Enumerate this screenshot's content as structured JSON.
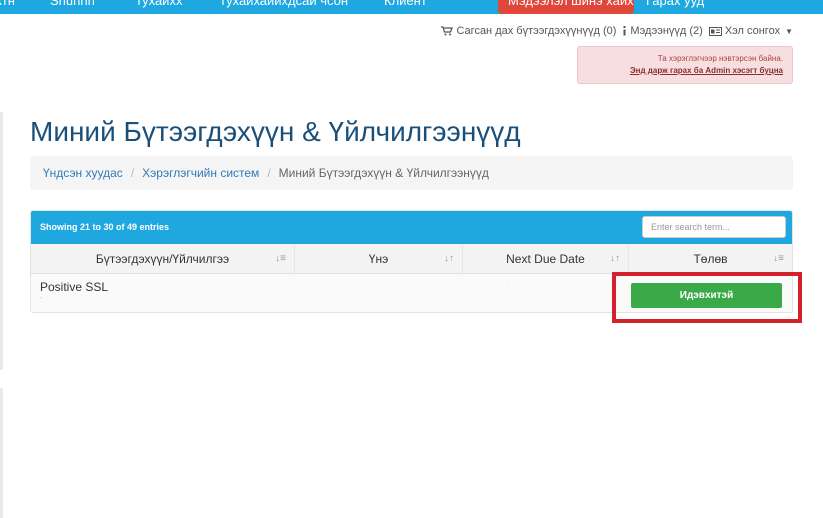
{
  "top_nav": {
    "items": [
      "ктн",
      "Shuhhh",
      "тухаихх",
      "тухаихаиихдсаи чсон",
      "Клиент"
    ],
    "highlight_label": "Мэдээлэл шинэ хайх",
    "right_item": "Гарах ууд"
  },
  "utility": {
    "cart_label": "Сагсан дах бүтээгдэхүүнүүд (0)",
    "notifications_label": "Мэдээнүүд (2)",
    "language_label": "Хэл сонгох"
  },
  "admin_alert": {
    "message": "Та хэрэглэгчээр нэвтэрсэн байна.",
    "link": "Энд дарж гарах ба Admin хэсэгт буцна"
  },
  "page": {
    "title": "Миний Бүтээгдэхүүн & Үйлчилгээнүүд"
  },
  "breadcrumb": {
    "home": "Үндсэн хуудас",
    "client_area": "Хэрэглэгчийн систем",
    "current": "Миний Бүтээгдэхүүн & Үйлчилгээнүүд"
  },
  "table": {
    "showing": "Showing 21 to 30 of 49 entries",
    "search_placeholder": "Enter search term...",
    "columns": [
      "Бүтээгдэхүүн/Үйлчилгээ",
      "Үнэ",
      "Next Due Date",
      "Төлөв"
    ],
    "rows": [
      {
        "product": "Positive SSL",
        "domain": "-",
        "price": "",
        "due_date": "-",
        "status": "Идэвхитэй"
      }
    ]
  },
  "colors": {
    "nav_blue": "#1fa8e0",
    "title_blue": "#1a4f7a",
    "status_green": "#3aaa48",
    "highlight_red": "#d4222c"
  },
  "icons": {
    "cart": "cart-icon",
    "notifications": "info-icon",
    "language": "language-icon",
    "sort_alpha": "sort-alpha-icon",
    "sort_default": "sort-icon"
  }
}
